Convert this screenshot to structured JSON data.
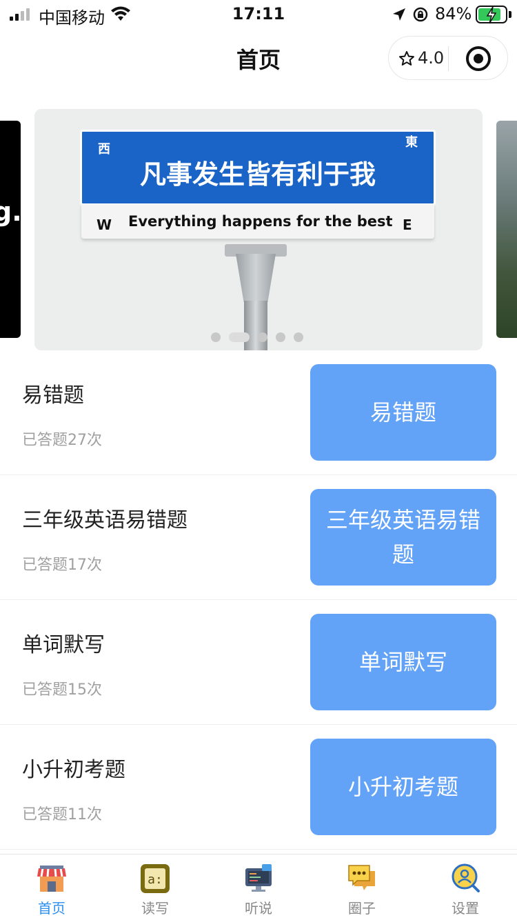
{
  "status_bar": {
    "carrier": "中国移动",
    "time": "17:11",
    "battery_percent": "84%",
    "battery_level": 0.84
  },
  "nav": {
    "title": "首页",
    "rating": "4.0"
  },
  "banner": {
    "prev_slide_text": "g.",
    "sign_chinese": "凡事发生皆有利于我",
    "sign_english": "Everything happens for the best",
    "west_cn": "西",
    "east_cn": "東",
    "west": "W",
    "east": "E",
    "slide_count": 5,
    "active_slide": 2
  },
  "items": [
    {
      "title": "易错题",
      "count": "已答题27次",
      "button": "易错题"
    },
    {
      "title": "三年级英语易错题",
      "count": "已答题17次",
      "button": "三年级英语易错题"
    },
    {
      "title": "单词默写",
      "count": "已答题15次",
      "button": "单词默写"
    },
    {
      "title": "小升初考题",
      "count": "已答题11次",
      "button": "小升初考题"
    }
  ],
  "tabs": [
    {
      "label": "首页",
      "icon": "shop-icon",
      "active": true
    },
    {
      "label": "读写",
      "icon": "read-write-icon",
      "active": false
    },
    {
      "label": "听说",
      "icon": "monitor-icon",
      "active": false
    },
    {
      "label": "圈子",
      "icon": "chat-icon",
      "active": false
    },
    {
      "label": "设置",
      "icon": "user-search-icon",
      "active": false
    }
  ],
  "colors": {
    "button": "#62a2f7",
    "tab_active": "#2a8ef0",
    "sign_blue": "#1a64c8"
  }
}
